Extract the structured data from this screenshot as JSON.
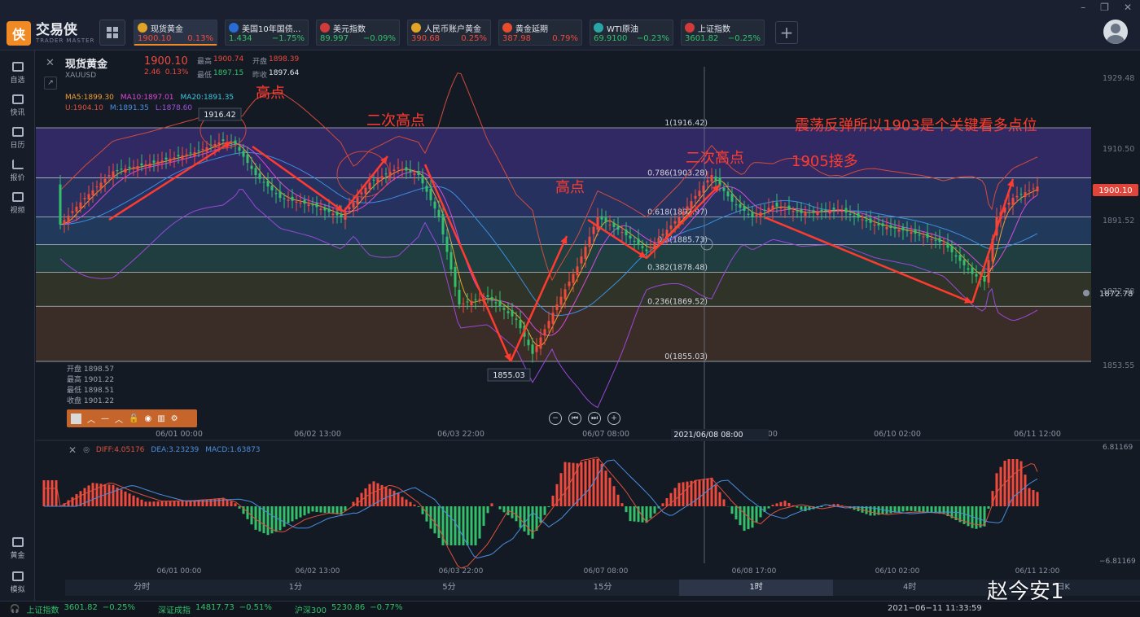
{
  "app": {
    "name": "交易侠",
    "subtitle": "TRADER MASTER",
    "logo_mark": "侠"
  },
  "tabs": [
    {
      "name": "现货黄金",
      "price": "1900.10",
      "change": "0.13%",
      "dir": "up",
      "icon_color": "#e0a526",
      "active": true
    },
    {
      "name": "美国10年国债...",
      "price": "1.434",
      "change": "−1.75%",
      "dir": "dn",
      "icon_color": "#2a6bd6",
      "active": false
    },
    {
      "name": "美元指数",
      "price": "89.997",
      "change": "−0.09%",
      "dir": "dn",
      "icon_color": "#d23b3b",
      "active": false
    },
    {
      "name": "人民币账户黄金",
      "price": "390.68",
      "change": "0.25%",
      "dir": "up",
      "icon_color": "#e0a526",
      "active": false
    },
    {
      "name": "黄金延期",
      "price": "387.98",
      "change": "0.79%",
      "dir": "up",
      "icon_color": "#e84c2e",
      "active": false
    },
    {
      "name": "WTI原油",
      "price": "69.9100",
      "change": "−0.23%",
      "dir": "dn",
      "icon_color": "#29a6a6",
      "active": false
    },
    {
      "name": "上证指数",
      "price": "3601.82",
      "change": "−0.25%",
      "dir": "dn",
      "icon_color": "#d23b3b",
      "active": false
    }
  ],
  "sidebar": {
    "top": [
      "自选",
      "快讯",
      "日历",
      "报价",
      "视频"
    ],
    "bottom": [
      "黄金",
      "模拟"
    ]
  },
  "symbol": {
    "name": "现货黄金",
    "code": "XAUUSD",
    "price": "1900.10",
    "change": "2.46",
    "change_pct": "0.13%",
    "high_label": "最高",
    "high": "1900.74",
    "open_label": "开盘",
    "open": "1898.39",
    "low_label": "最低",
    "low": "1897.15",
    "prev_label": "昨收",
    "prev": "1897.64"
  },
  "ma": {
    "ma5": "MA5:1899.30",
    "ma10": "MA10:1897.01",
    "ma20": "MA20:1891.35",
    "u": "U:1904.10",
    "m": "M:1891.35",
    "l": "L:1878.60"
  },
  "ohlc_box": {
    "open": "开盘 1898.57",
    "high": "最高 1901.22",
    "low": "最低 1898.51",
    "close": "收盘 1901.22"
  },
  "price_axis": [
    "1929.48",
    "1910.50",
    "1891.52",
    "1872.78",
    "1853.55"
  ],
  "current_price_tag": "1900.10",
  "alert_price_tag": "1872.78",
  "fib_levels": [
    {
      "label": "1(1916.42)",
      "y": 1916.42
    },
    {
      "label": "0.786(1903.28)",
      "y": 1903.28
    },
    {
      "label": "0.618(1892.97)",
      "y": 1892.97
    },
    {
      "label": "0.5(1885.73)",
      "y": 1885.73
    },
    {
      "label": "0.382(1878.48)",
      "y": 1878.48
    },
    {
      "label": "0.236(1869.52)",
      "y": 1869.52
    },
    {
      "label": "0(1855.03)",
      "y": 1855.03
    }
  ],
  "marks": {
    "high_mark": "1916.42",
    "low_mark": "1855.03"
  },
  "annotations": {
    "a1": "高点",
    "a2": "二次高点",
    "a3": "高点",
    "a4": "二次高点",
    "a5": "震荡反弹所以1903是个关键看多点位",
    "a6": "1905接多"
  },
  "time_axis": [
    "06/01 00:00",
    "06/02 13:00",
    "06/03 22:00",
    "06/07 08:00",
    "06/08 17:00",
    "06/10 02:00",
    "06/11 12:00"
  ],
  "crosshair_time": "2021/06/08 08:00",
  "macd": {
    "diff": "DIFF:4.05176",
    "dea": "DEA:3.23239",
    "macd": "MACD:1.63873",
    "axis_top": "6.81169",
    "axis_bottom": "−6.81169"
  },
  "periods": [
    "分时",
    "1分",
    "5分",
    "15分",
    "1时",
    "4时",
    "日K"
  ],
  "active_period": "1时",
  "status": {
    "sh_name": "上证指数",
    "sh_val": "3601.82",
    "sh_chg": "−0.25%",
    "sz_name": "深证成指",
    "sz_val": "14817.73",
    "sz_chg": "−0.51%",
    "hs_name": "沪深300",
    "hs_val": "5230.86",
    "hs_chg": "−0.77%",
    "time": "2021−06−11 11:33:59"
  },
  "watermark": "赵今安1",
  "colors": {
    "up": "#ef4a3c",
    "down": "#33c06a",
    "accent": "#f08a24",
    "annotation": "#ff3b30"
  }
}
